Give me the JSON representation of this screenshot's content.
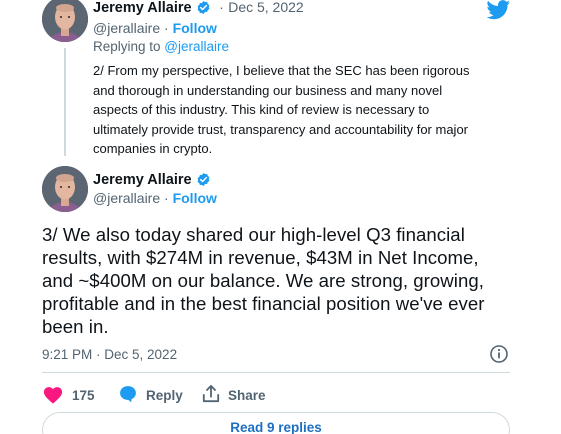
{
  "reply_tweet": {
    "author_name": "Jeremy Allaire",
    "date_sep": "·",
    "date": "Dec 5, 2022",
    "handle": "@jerallaire",
    "follow_label": "Follow",
    "replying_prefix": "Replying to ",
    "replying_handle": "@jerallaire",
    "text": "2/ From my perspective, I believe that the SEC has been rigorous\nand thorough in understanding our business and many novel\naspects of this industry.  This kind of review is necessary to\nultimately provide trust, transparency and accountability for major\ncompanies in crypto."
  },
  "main_tweet": {
    "author_name": "Jeremy Allaire",
    "handle": "@jerallaire",
    "follow_label": "Follow",
    "text": "3/ We also today shared our high-level Q3 financial\nresults, with $274M in revenue, $43M in Net Income,\nand ~$400M on our balance.  We are strong, growing,\nprofitable and in the best financial position we've ever\nbeen in.",
    "timestamp": "9:21 PM · Dec 5, 2022",
    "likes_count": "175",
    "reply_label": "Reply",
    "share_label": "Share",
    "read_replies_label": "Read 9 replies"
  },
  "icons": {
    "brand": "twitter-bird-icon",
    "verified": "verified-badge-icon",
    "info": "info-icon",
    "like": "heart-icon",
    "reply": "speech-bubble-icon",
    "share": "share-upload-icon"
  },
  "colors": {
    "twitter_blue": "#1d9bf0",
    "like_pink": "#f91880",
    "text": "#0f1419",
    "muted": "#536471",
    "border": "#cfd9de"
  }
}
